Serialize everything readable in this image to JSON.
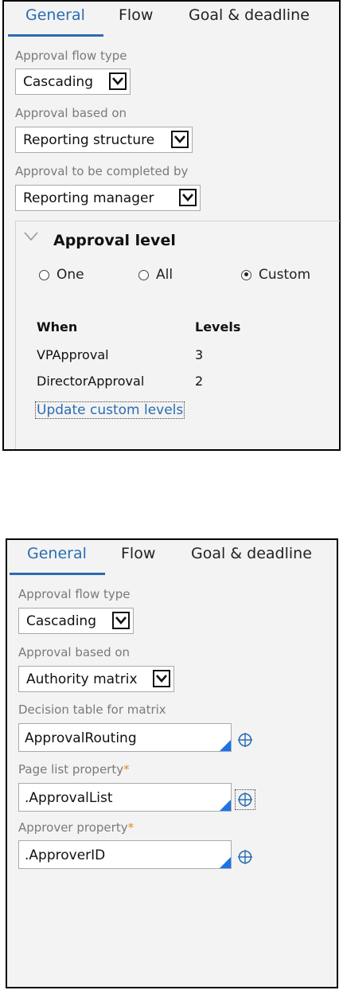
{
  "panel1": {
    "tabs": [
      {
        "label": "General",
        "active": true
      },
      {
        "label": "Flow",
        "active": false
      },
      {
        "label": "Goal & deadline",
        "active": false
      }
    ],
    "approval_flow_type": {
      "label": "Approval flow type",
      "value": "Cascading"
    },
    "approval_based_on": {
      "label": "Approval based on",
      "value": "Reporting structure"
    },
    "approval_completed_by": {
      "label": "Approval to be completed by",
      "value": "Reporting manager"
    },
    "approval_level": {
      "title": "Approval level",
      "options": [
        {
          "label": "One",
          "selected": false
        },
        {
          "label": "All",
          "selected": false
        },
        {
          "label": "Custom",
          "selected": true
        }
      ],
      "table": {
        "headers": [
          "When",
          "Levels"
        ],
        "rows": [
          [
            "VPApproval",
            "3"
          ],
          [
            "DirectorApproval",
            "2"
          ]
        ]
      },
      "update_link": "Update custom levels"
    }
  },
  "panel2": {
    "tabs": [
      {
        "label": "General",
        "active": true
      },
      {
        "label": "Flow",
        "active": false
      },
      {
        "label": "Goal & deadline",
        "active": false
      }
    ],
    "approval_flow_type": {
      "label": "Approval flow type",
      "value": "Cascading"
    },
    "approval_based_on": {
      "label": "Approval based on",
      "value": "Authority matrix"
    },
    "decision_table": {
      "label": "Decision table for matrix",
      "value": "ApprovalRouting"
    },
    "page_list_property": {
      "label": "Page list property",
      "required_mark": "*",
      "value": ".ApprovalList"
    },
    "approver_property": {
      "label": "Approver property",
      "required_mark": "*",
      "value": ".ApproverID"
    }
  },
  "colors": {
    "accent": "#2a6db3",
    "required": "#e0892a",
    "corner": "#1a73e8",
    "panel_bg": "#f3f3f3"
  },
  "icons": [
    "chevron-down-icon",
    "crosshair-target-icon"
  ]
}
